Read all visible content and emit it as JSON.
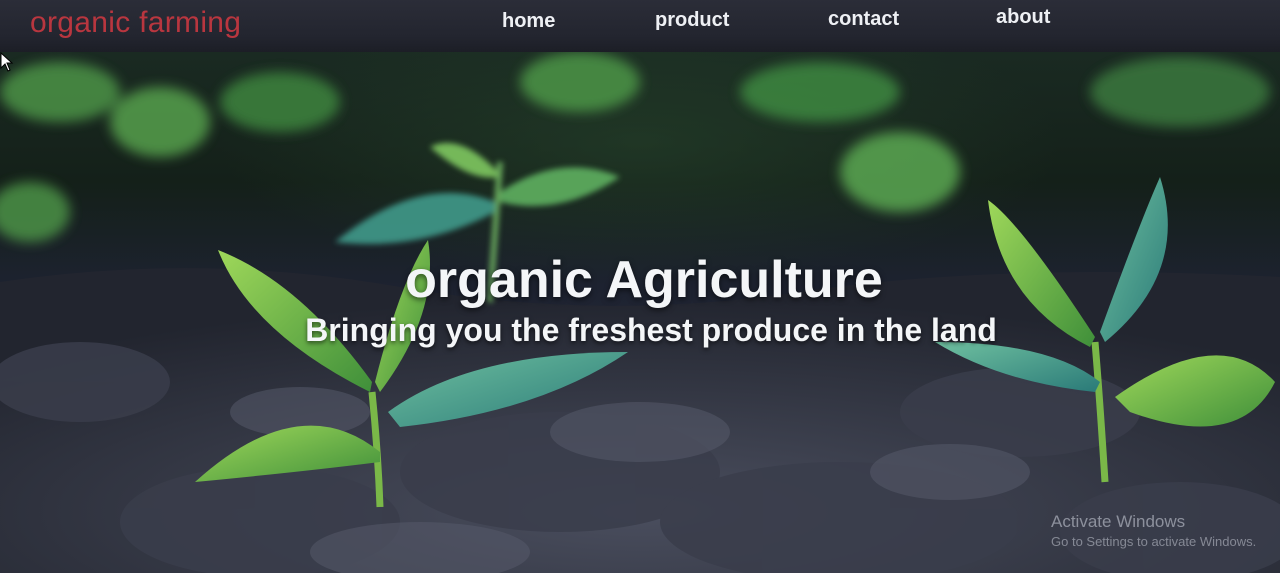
{
  "navbar": {
    "brand": "organic farming",
    "links": [
      "home",
      "product",
      "contact",
      "about"
    ]
  },
  "hero": {
    "title": "organic Agriculture",
    "subtitle": "Bringing you the freshest produce in the land"
  },
  "os_watermark": {
    "title": "Activate Windows",
    "subtitle": "Go to Settings to activate Windows."
  },
  "colors": {
    "brand": "#b9363f",
    "navbar_bg": "#23252f",
    "nav_text": "#eef0f4",
    "hero_text": "#f4f6f8"
  }
}
